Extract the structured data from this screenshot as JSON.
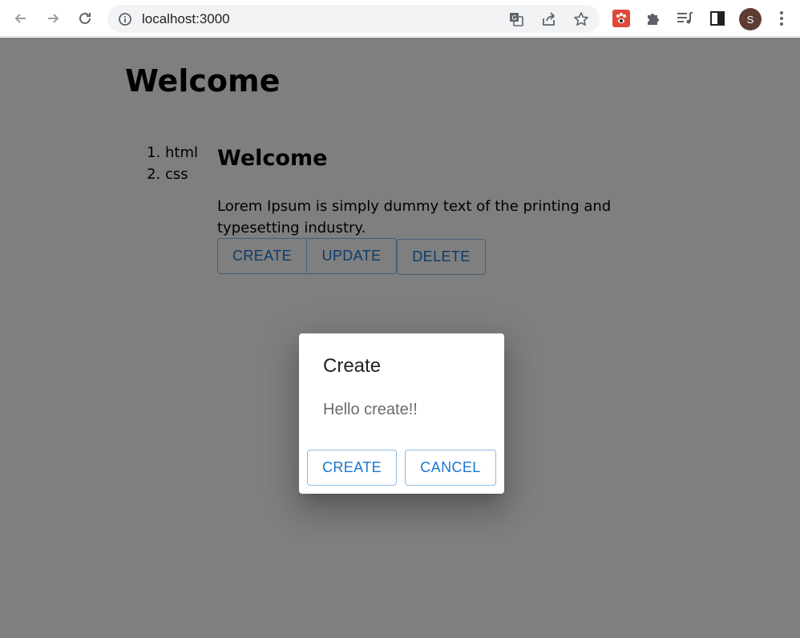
{
  "browser": {
    "url": "localhost:3000",
    "profile_initial": "S",
    "icons": {
      "back": "arrow-left-icon",
      "forward": "arrow-right-icon",
      "reload": "reload-icon",
      "site_info": "info-icon",
      "translate": "translate-icon",
      "share": "share-icon",
      "bookmark": "star-icon",
      "extension": "paw-extension-icon",
      "extensions": "puzzle-icon",
      "media": "media-queue-icon",
      "side_panel": "side-panel-icon",
      "menu": "kebab-menu-icon"
    }
  },
  "page": {
    "heading": "Welcome",
    "toc": [
      "html",
      "css"
    ],
    "section_heading": "Welcome",
    "paragraph": "Lorem Ipsum is simply dummy text of the printing and typesetting industry.",
    "buttons": {
      "create": "CREATE",
      "update": "UPDATE",
      "delete": "DELETE"
    }
  },
  "dialog": {
    "title": "Create",
    "text": "Hello create!!",
    "create_label": "CREATE",
    "cancel_label": "CANCEL"
  },
  "colors": {
    "accent": "#1976d2",
    "backdrop": "rgba(0,0,0,0.5)",
    "avatar": "#5d3d33"
  }
}
